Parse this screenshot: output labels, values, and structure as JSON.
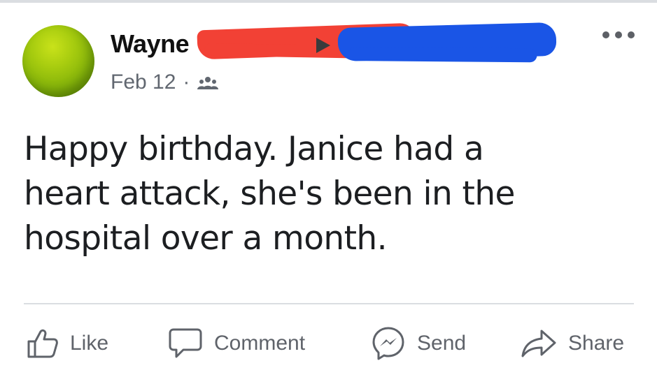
{
  "post": {
    "author_name": "Wayne",
    "date": "Feb 12",
    "separator": "·",
    "body": "Happy birthday. Janice had a\nheart attack, she's been in the\nhospital over a month.",
    "audience_icon": "friends-icon",
    "more_icon": "more-options-icon"
  },
  "actions": {
    "like": "Like",
    "comment": "Comment",
    "send": "Send",
    "share": "Share"
  },
  "colors": {
    "redaction_red": "#f24135",
    "redaction_blue": "#1a55e6",
    "avatar_green": "#8fbd0b",
    "meta_text": "#616770"
  }
}
